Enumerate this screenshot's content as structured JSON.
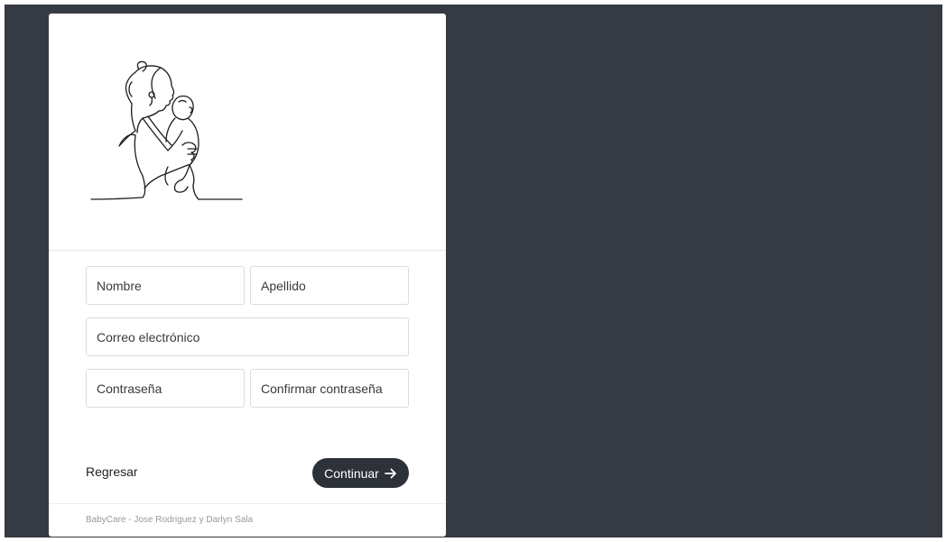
{
  "colors": {
    "background": "#363a42",
    "card": "#ffffff",
    "button": "#2d3139"
  },
  "illustration": {
    "icon": "mother-holding-baby-line-art"
  },
  "form": {
    "first_name": {
      "placeholder": "Nombre",
      "value": ""
    },
    "last_name": {
      "placeholder": "Apellido",
      "value": ""
    },
    "email": {
      "placeholder": "Correo electrónico",
      "value": ""
    },
    "password": {
      "placeholder": "Contraseña",
      "value": ""
    },
    "confirm_password": {
      "placeholder": "Confirmar contraseña",
      "value": ""
    }
  },
  "actions": {
    "back_label": "Regresar",
    "continue_label": "Continuar",
    "continue_icon": "arrow-right-icon"
  },
  "footer": {
    "text": "BabyCare - Jose Rodriguez y Darlyn Sala"
  }
}
